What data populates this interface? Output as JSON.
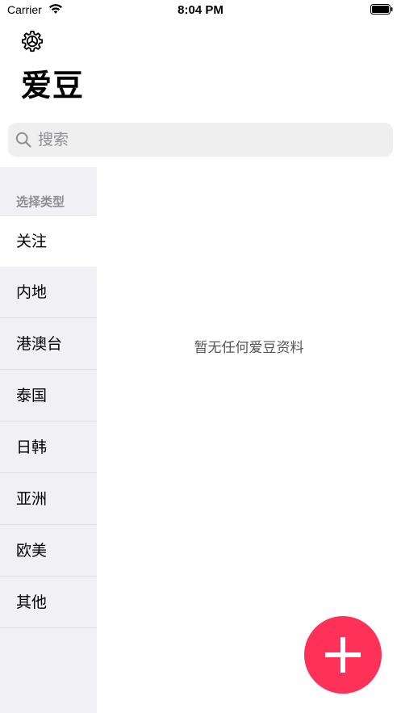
{
  "status_bar": {
    "carrier": "Carrier",
    "time": "8:04 PM"
  },
  "header": {
    "title": "爱豆"
  },
  "search": {
    "placeholder": "搜索"
  },
  "sidebar": {
    "header": "选择类型",
    "selected_index": 0,
    "items": [
      {
        "label": "关注"
      },
      {
        "label": "内地"
      },
      {
        "label": "港澳台"
      },
      {
        "label": "泰国"
      },
      {
        "label": "日韩"
      },
      {
        "label": "亚洲"
      },
      {
        "label": "欧美"
      },
      {
        "label": "其他"
      }
    ]
  },
  "main": {
    "empty_text": "暂无任何爱豆资料"
  },
  "colors": {
    "accent": "#fe3158",
    "sidebar_bg": "#f0f0f5",
    "search_bg": "#efeff0",
    "secondary_text": "#8e8e93"
  },
  "icons": {
    "settings": "gear-icon",
    "search": "search-icon",
    "add": "plus-icon"
  }
}
